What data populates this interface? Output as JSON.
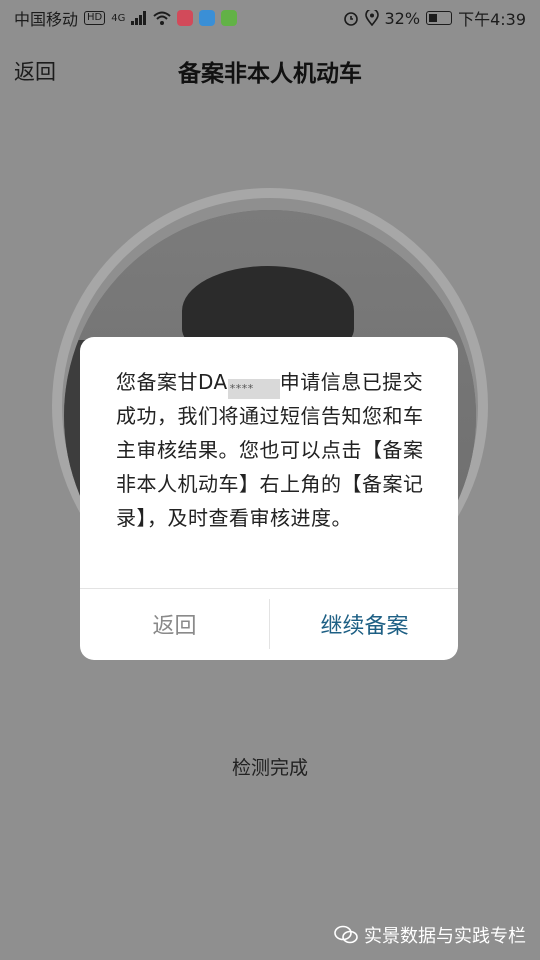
{
  "statusbar": {
    "carrier": "中国移动",
    "hd": "HD",
    "network": "4G",
    "battery_percent": "32%",
    "time": "下午4:39"
  },
  "appbar": {
    "back_label": "返回",
    "title": "备案非本人机动车"
  },
  "dialog": {
    "msg_part1": "您备案甘DA",
    "masked_plate": "****",
    "msg_part2": "申请信息已提交成功，我们将通过短信告知您和车主审核结果。您也可以点击【备案非本人机动车】右上角的【备案记录】，及时查看审核进度。",
    "cancel_label": "返回",
    "confirm_label": "继续备案"
  },
  "detect_status": "检测完成",
  "watermark": {
    "text": "实景数据与实践专栏"
  },
  "colors": {
    "overlay": "#8f8f8f",
    "confirm_text": "#1d5f84",
    "cancel_text": "#8a8a8a"
  },
  "icons": [
    "wifi-icon",
    "signal-icon",
    "alarm-icon",
    "location-icon",
    "battery-icon",
    "wechat-icon"
  ]
}
